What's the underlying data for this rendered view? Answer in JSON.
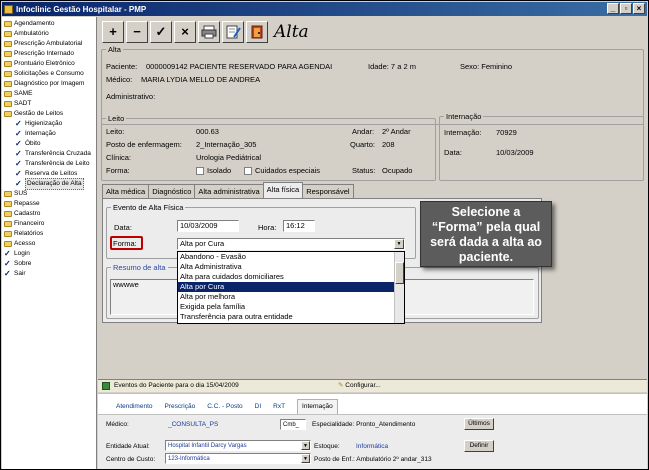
{
  "window": {
    "title": "Infoclinic Gestão Hospitalar - PMP"
  },
  "tree": [
    {
      "label": "Agendamento",
      "type": "folder",
      "sub": false
    },
    {
      "label": "Ambulatório",
      "type": "folder",
      "sub": false
    },
    {
      "label": "Prescrição Ambulatorial",
      "type": "folder",
      "sub": false
    },
    {
      "label": "Prescrição Internado",
      "type": "folder",
      "sub": false
    },
    {
      "label": "Prontuário Eletrônico",
      "type": "folder",
      "sub": false
    },
    {
      "label": "Solicitações e Consumo",
      "type": "folder",
      "sub": false
    },
    {
      "label": "Diagnóstico por Imagem",
      "type": "folder",
      "sub": false
    },
    {
      "label": "SAME",
      "type": "folder",
      "sub": false
    },
    {
      "label": "SADT",
      "type": "folder",
      "sub": false
    },
    {
      "label": "Gestão de Leitos",
      "type": "folder",
      "sub": false
    },
    {
      "label": "Higienização",
      "type": "check",
      "sub": true
    },
    {
      "label": "Internação",
      "type": "check",
      "sub": true
    },
    {
      "label": "Óbito",
      "type": "check",
      "sub": true
    },
    {
      "label": "Transferência Cruzada",
      "type": "check",
      "sub": true
    },
    {
      "label": "Transferência de Leito",
      "type": "check",
      "sub": true
    },
    {
      "label": "Reserva de Leitos",
      "type": "check",
      "sub": true
    },
    {
      "label": "Declaração de Alta",
      "type": "check",
      "sub": true,
      "selected": true
    },
    {
      "label": "SUS",
      "type": "folder",
      "sub": false
    },
    {
      "label": "Repasse",
      "type": "folder",
      "sub": false
    },
    {
      "label": "Cadastro",
      "type": "folder",
      "sub": false
    },
    {
      "label": "Financeiro",
      "type": "folder",
      "sub": false
    },
    {
      "label": "Relatórios",
      "type": "folder",
      "sub": false
    },
    {
      "label": "Acesso",
      "type": "folder",
      "sub": false
    },
    {
      "label": "Login",
      "type": "check",
      "sub": false
    },
    {
      "label": "Sobre",
      "type": "check",
      "sub": false
    },
    {
      "label": "Sair",
      "type": "check",
      "sub": false
    }
  ],
  "toolbar": {
    "add": "+",
    "remove": "−",
    "confirm": "✓",
    "cancel": "×",
    "title": "Alta"
  },
  "alta": {
    "legend": "Alta",
    "paciente_label": "Paciente:",
    "paciente_value": "0000009142      PACIENTE RESERVADO PARA AGENDAI",
    "idade": "Idade: 7 a 2 m",
    "sexo": "Sexo: Feminino",
    "medico_label": "Médico:",
    "medico_value": "MARIA LYDIA MELLO DE ANDREA",
    "administrativo_label": "Administrativo:"
  },
  "leito": {
    "legend": "Leito",
    "leito_label": "Leito:",
    "leito_value": "000.63",
    "posto_label": "Posto de enfermagem:",
    "posto_value": "2_Internação_305",
    "clinica_label": "Clínica:",
    "clinica_value": "Urologia Pediátrical",
    "forma_label": "Forma:",
    "isolado": "Isolado",
    "cuidados": "Cuidados especiais",
    "andar_label": "Andar:",
    "andar_value": "2º Andar",
    "quarto_label": "Quarto:",
    "quarto_value": "208",
    "status_label": "Status:",
    "status_value": "Ocupado"
  },
  "internacao": {
    "legend": "Internação",
    "internacao_label": "Internação:",
    "internacao_value": "70929",
    "data_label": "Data:",
    "data_value": "10/03/2009"
  },
  "tabs": [
    "Alta médica",
    "Diagnóstico",
    "Alta administrativa",
    "Alta física",
    "Responsável"
  ],
  "evento": {
    "legend": "Evento de Alta Física",
    "data_label": "Data:",
    "data_value": "10/03/2009",
    "hora_label": "Hora:",
    "hora_value": "16:12",
    "forma_label": "Forma:",
    "forma_value": "Alta por Cura",
    "resumo_legend": "Resumo de alta",
    "resumo_value": "wwwwe"
  },
  "forma_options": [
    "Abandono - Evasão",
    "Alta Administrativa",
    "Alta para cuidados domiciliares",
    "Alta por Cura",
    "Alta por melhora",
    "Exigida pela família",
    "Transferência para outra entidade"
  ],
  "forma_selected_index": 3,
  "callout": {
    "line1": "Selecione a",
    "line2": "“Forma” pela qual",
    "line3": "será dada a alta ao",
    "line4": "paciente."
  },
  "bottom": {
    "eventos": "Eventos do Paciente para o dia 15/04/2009",
    "configurar": "Configurar...",
    "tabs": [
      "Atendimento",
      "Prescrição",
      "C.C. - Posto",
      "DI",
      "RxT",
      "Internação"
    ],
    "medico_label": "Médico:",
    "medico_value": "_CONSULTA_PS",
    "cmb": "Cmb_",
    "especialidade": "Especialidade: Pronto_Atendimento",
    "ultimos": "Últimos",
    "entidade_label": "Entidade Atual:",
    "entidade_value": "Hospital Infantil Darcy Vargas",
    "estoque_label": "Estoque:",
    "estoque_value": "Informática",
    "definir": "Definir",
    "centro_label": "Centro de Custo:",
    "centro_value": "123-Informática",
    "posto": "Posto de Enf.: Ambulatório 2º andar_313"
  }
}
